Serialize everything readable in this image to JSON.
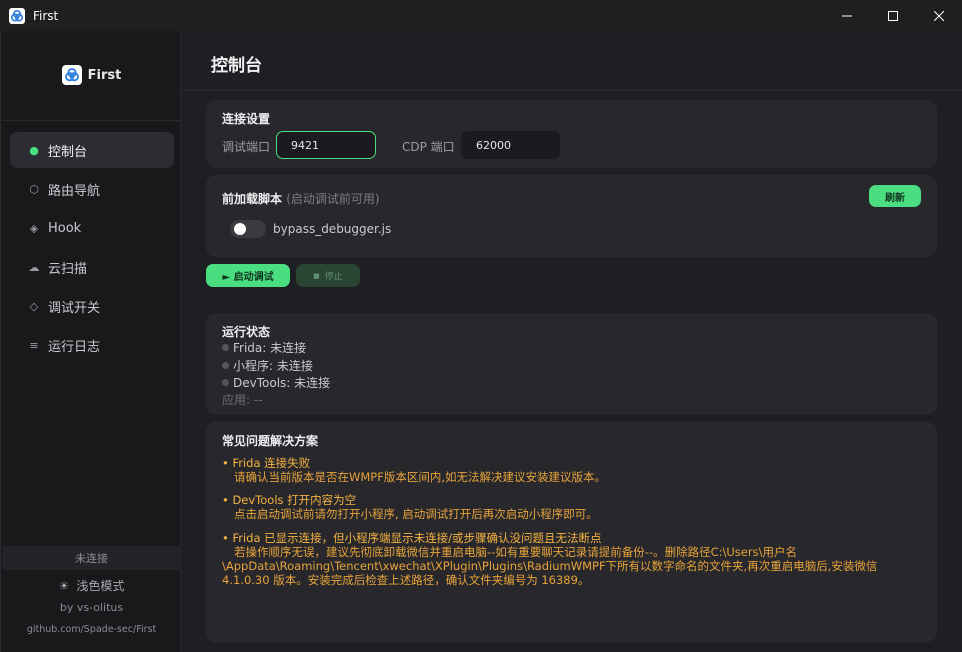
{
  "window": {
    "title": "First",
    "controls": {
      "minimize": "—",
      "maximize": "☐",
      "close": "✕"
    }
  },
  "sidebar": {
    "brand": "First",
    "items": [
      {
        "label": "控制台",
        "icon": "●"
      },
      {
        "label": "路由导航",
        "icon": "⬡"
      },
      {
        "label": "Hook",
        "icon": "◈"
      },
      {
        "label": "云扫描",
        "icon": "☁"
      },
      {
        "label": "调试开关",
        "icon": "◇"
      },
      {
        "label": "运行日志",
        "icon": "≡"
      }
    ],
    "status": "未连接",
    "theme_icon": "☀",
    "theme_label": "浅色模式",
    "byline": "by vs-olitus",
    "repo": "github.com/Spade-sec/First"
  },
  "page": {
    "title": "控制台"
  },
  "connection": {
    "title": "连接设置",
    "debug_port_label": "调试端口",
    "debug_port_value": "9421",
    "cdp_port_label": "CDP 端口",
    "cdp_port_value": "62000"
  },
  "preload": {
    "title": "前加载脚本",
    "hint": "(启动调试前可用)",
    "refresh_label": "刷新",
    "script_name": "bypass_debugger.js",
    "script_enabled": false
  },
  "actions": {
    "start_label": "► 启动调试",
    "stop_icon": "■",
    "stop_label": "停止"
  },
  "status": {
    "title": "运行状态",
    "frida": "Frida: 未连接",
    "miniprogram": "小程序: 未连接",
    "devtools": "DevTools: 未连接",
    "app": "应用: --"
  },
  "faq": {
    "title": "常见问题解决方案",
    "items": [
      {
        "q": "• Frida 连接失败",
        "a": [
          "请确认当前版本是否在WMPF版本区间内,如无法解决建议安装建议版本。"
        ]
      },
      {
        "q": "• DevTools 打开内容为空",
        "a": [
          "点击启动调试前请勿打开小程序, 启动调试打开后再次启动小程序即可。"
        ]
      },
      {
        "q": "• Frida 已显示连接，但小程序端显示未连接/或步骤确认没问题且无法断点",
        "a": [
          "若操作顺序无误，建议先彻底卸载微信并重启电脑--如有重要聊天记录请提前备份--。删除路径C:\\Users\\用户名",
          "\\AppData\\Roaming\\Tencent\\xwechat\\XPlugin\\Plugins\\RadiumWMPF下所有以数字命名的文件夹,再次重启电脑后,安装微信",
          "4.1.0.30 版本。安装完成后检查上述路径，确认文件夹编号为 16389。"
        ]
      }
    ]
  },
  "colors": {
    "accent": "#4ade80",
    "warning": "#f0a93a",
    "card": "#27272c",
    "background": "#1e1f22"
  }
}
